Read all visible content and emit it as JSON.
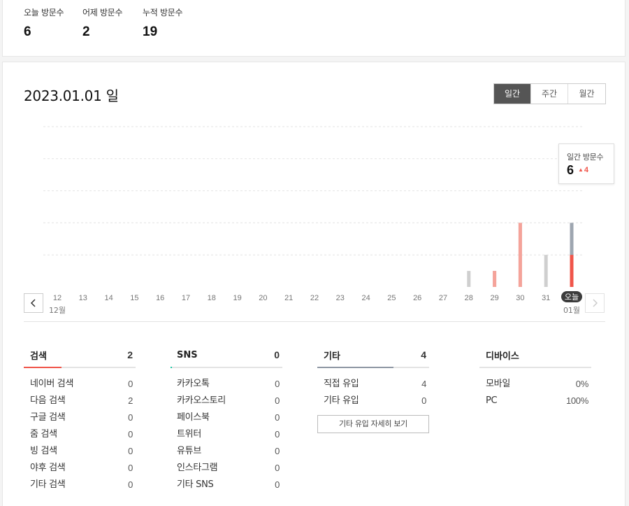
{
  "summary": {
    "today_label": "오늘 방문수",
    "today_value": "6",
    "yesterday_label": "어제 방문수",
    "yesterday_value": "2",
    "total_label": "누적 방문수",
    "total_value": "19"
  },
  "header": {
    "date": "2023.01.01 일"
  },
  "period_tabs": [
    "일간",
    "주간",
    "월간"
  ],
  "active_period": "일간",
  "tooltip": {
    "label": "일간 방문수",
    "value": "6",
    "delta": "4",
    "delta_color": "#f0554a"
  },
  "chart_data": {
    "type": "bar",
    "categories": [
      "12",
      "13",
      "14",
      "15",
      "16",
      "17",
      "18",
      "19",
      "20",
      "21",
      "22",
      "23",
      "24",
      "25",
      "26",
      "27",
      "28",
      "29",
      "30",
      "31",
      "오늘"
    ],
    "month_labels": [
      {
        "index": 0,
        "label": "12월"
      },
      {
        "index": 20,
        "label": "01월"
      }
    ],
    "series": [
      {
        "values": [
          0,
          0,
          0,
          0,
          0,
          0,
          0,
          0,
          0,
          0,
          0,
          0,
          0,
          0,
          0,
          0,
          1,
          1,
          4,
          2,
          4
        ],
        "color": "#cfcfcf"
      },
      {
        "values": [
          0,
          0,
          0,
          0,
          0,
          0,
          0,
          0,
          0,
          0,
          0,
          0,
          0,
          0,
          0,
          0,
          0,
          1,
          4,
          0,
          2
        ],
        "color": "#f5a39a"
      }
    ],
    "selected_index": 20,
    "selected_colors": {
      "total": "#9ea6b0",
      "highlight": "#f0554a"
    },
    "ylim": [
      0,
      10
    ],
    "grid": true
  },
  "sections": [
    {
      "title": "검색",
      "count": "2",
      "bar_ratio": 0.34,
      "bar_color": "#f0554a",
      "rows": [
        {
          "label": "네이버 검색",
          "value": "0"
        },
        {
          "label": "다음 검색",
          "value": "2"
        },
        {
          "label": "구글 검색",
          "value": "0"
        },
        {
          "label": "줌 검색",
          "value": "0"
        },
        {
          "label": "빙 검색",
          "value": "0"
        },
        {
          "label": "야후 검색",
          "value": "0"
        },
        {
          "label": "기타 검색",
          "value": "0"
        }
      ]
    },
    {
      "title": "SNS",
      "count": "0",
      "bar_ratio": 0.01,
      "bar_color": "#1ec8a5",
      "rows": [
        {
          "label": "카카오톡",
          "value": "0"
        },
        {
          "label": "카카오스토리",
          "value": "0"
        },
        {
          "label": "페이스북",
          "value": "0"
        },
        {
          "label": "트위터",
          "value": "0"
        },
        {
          "label": "유튜브",
          "value": "0"
        },
        {
          "label": "인스타그램",
          "value": "0"
        },
        {
          "label": "기타 SNS",
          "value": "0"
        }
      ]
    },
    {
      "title": "기타",
      "count": "4",
      "bar_ratio": 0.68,
      "bar_color": "#8e97a3",
      "rows": [
        {
          "label": "직접 유입",
          "value": "4"
        },
        {
          "label": "기타 유입",
          "value": "0"
        }
      ],
      "button_label": "기타 유입 자세히 보기"
    },
    {
      "title": "디바이스",
      "count": "",
      "bar_ratio": 0,
      "bar_color": "#cccccc",
      "rows": [
        {
          "label": "모바일",
          "value": "0%"
        },
        {
          "label": "PC",
          "value": "100%"
        }
      ]
    }
  ]
}
